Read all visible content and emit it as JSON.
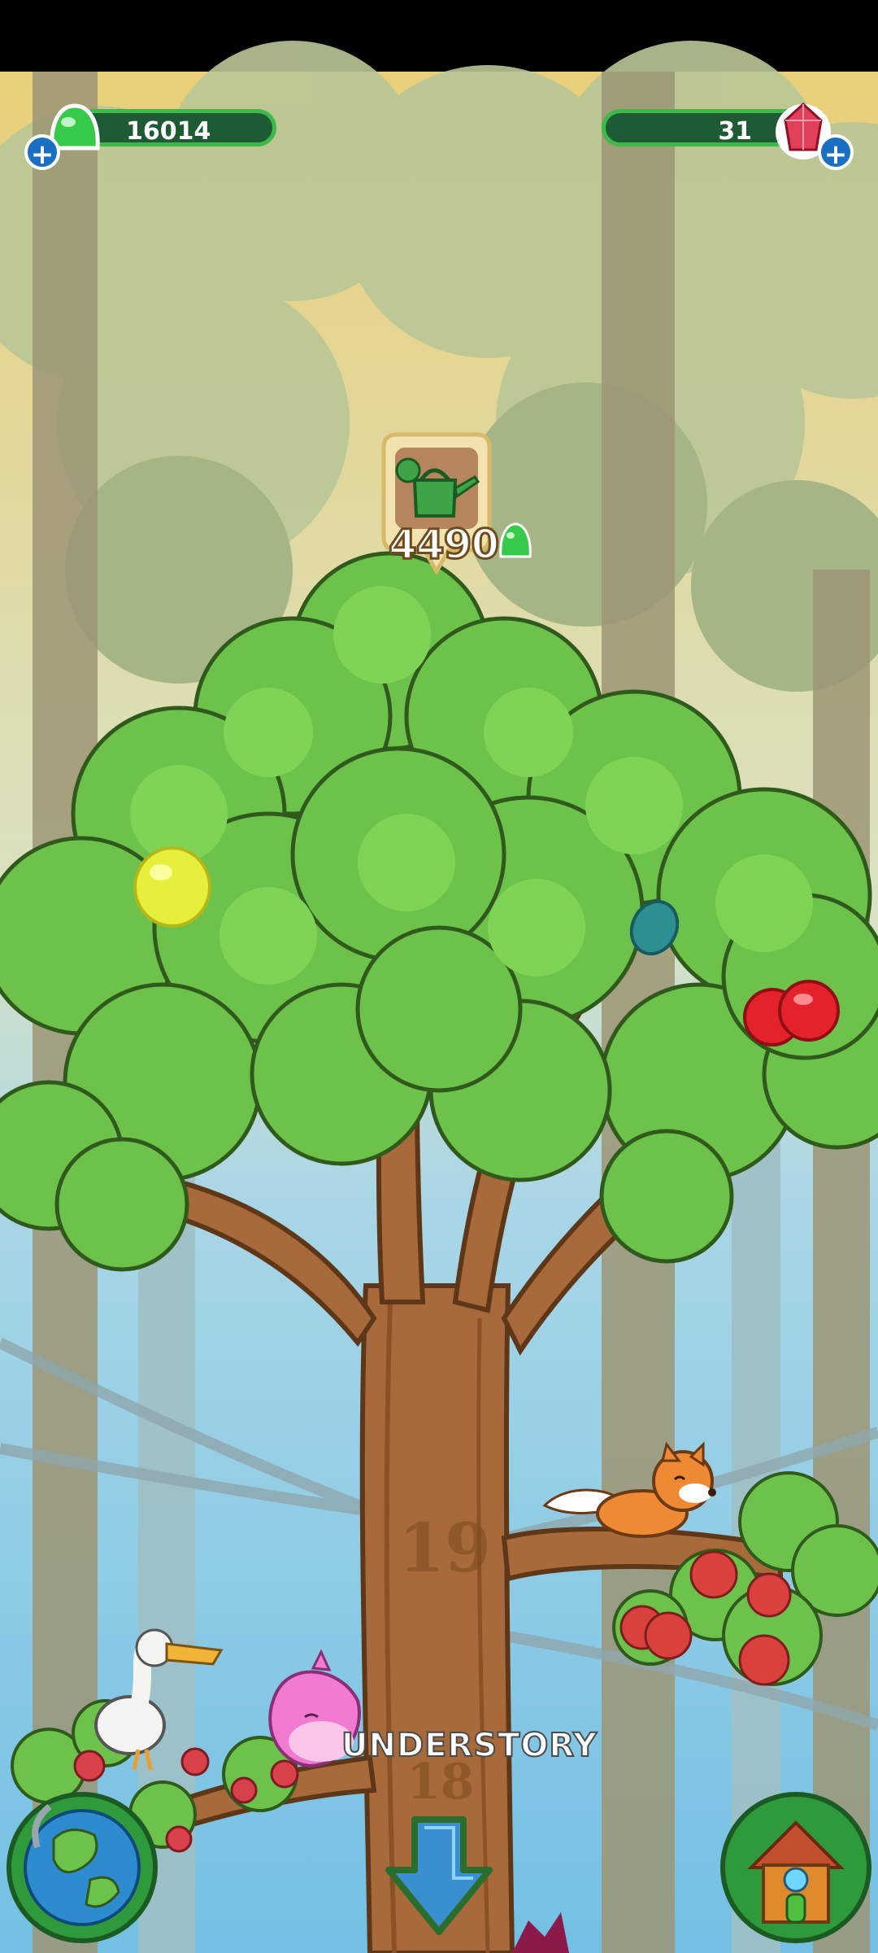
{
  "hud": {
    "jelly_count": "16014",
    "gem_count": "31",
    "jelly_icon": "green-jelly-icon",
    "gem_icon": "red-gem-icon",
    "add_icon": "plus-icon"
  },
  "watering": {
    "cost": "4490",
    "icon": "watering-can-icon",
    "currency_icon": "green-jelly-icon"
  },
  "tree": {
    "level_upper": "19",
    "level_lower": "18",
    "layer_name": "UNDERSTORY"
  },
  "creatures": [
    "fox",
    "pelican",
    "pink-axolotl"
  ],
  "fruits": [
    "yellow-fruit",
    "teal-seed",
    "red-cherries",
    "apples"
  ],
  "nav": {
    "left_icon": "globe-icon",
    "right_icon": "house-icon",
    "center_icon": "down-arrow-icon"
  },
  "colors": {
    "hud_bar": "#1e5a33",
    "hud_border": "#3fb84a",
    "leaf": "#6cc24a",
    "trunk": "#a86a3a"
  }
}
